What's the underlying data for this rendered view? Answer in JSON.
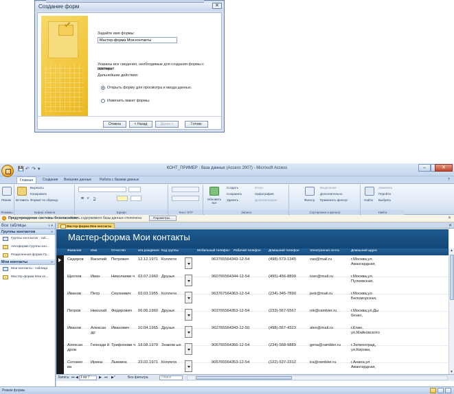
{
  "wizard": {
    "title": "Создание форм",
    "close_glyph": "✕",
    "prompt": "Задайте имя формы:",
    "form_name": "Мастер-форма Мои контакты",
    "info_line1": "Указаны все сведения, необходимые для создания формы с помощью",
    "info_line2": "мастера.",
    "next_actions": "Дальнейшие действия:",
    "option_open": "Открыть форму для просмотра и ввода данных.",
    "option_modify": "Изменить макет формы.",
    "buttons": {
      "cancel": "Отмена",
      "back": "< Назад",
      "next": "Далее >",
      "finish": "Готово"
    }
  },
  "app": {
    "window_title": "КОНТ_ПРИМЕР : база данных (Access 2007) - Microsoft Access",
    "qat": [
      "💾",
      "↶",
      "↷",
      "▾"
    ],
    "window_buttons": {
      "minimize": "–",
      "maximize": "□",
      "close": "✕"
    },
    "tabs": [
      "Главная",
      "Создание",
      "Внешние данные",
      "Работа с базами данных"
    ],
    "help_glyph": "?",
    "ribbon": {
      "modes": {
        "label": "Режимы",
        "view": "Режим"
      },
      "clipboard": {
        "label": "Буфер обмена",
        "paste": "Вставить",
        "cut": "Вырезать",
        "copy": "Копировать",
        "format_painter": "Формат по образцу"
      },
      "font": {
        "label": "Шрифт",
        "bold": "Ж",
        "italic": "К",
        "underline": "Ч"
      },
      "rich_text": {
        "label": "Текст RTF"
      },
      "records": {
        "label": "Записи",
        "refresh": "Обновить все",
        "new": "Создать",
        "save": "Сохранить",
        "delete": "Удалить",
        "totals": "Итоги",
        "spelling": "Орфография",
        "more": "Дополнительно"
      },
      "sort_filter": {
        "label": "Сортировка и фильтр",
        "filter": "Фильтр",
        "selection": "Выделение",
        "advanced": "Дополнительно",
        "toggle": "Применить фильтр"
      },
      "find": {
        "label": "Найти",
        "find": "Найти",
        "replace": "Заменить",
        "goto": "Перейти",
        "select": "Выбрать"
      }
    },
    "security": {
      "title": "Предупреждение системы безопасности",
      "text": "Часть содержимого базы данных отключена",
      "button": "Параметры...",
      "close_glyph": "✕"
    },
    "nav": {
      "title": "Все таблицы",
      "controls": "« ▾",
      "groups": [
        {
          "label": "Группы контактов",
          "items": [
            {
              "label": "Группы контактов : таб...",
              "type": "table"
            },
            {
              "label": "Автоформа Группы кон...",
              "type": "form"
            },
            {
              "label": "Разделенная форма Гр...",
              "type": "form"
            }
          ]
        },
        {
          "label": "Мои контакты",
          "items": [
            {
              "label": "Мои контакты : таблица",
              "type": "table"
            },
            {
              "label": "Мастер-форма Мои ко...",
              "type": "form"
            }
          ]
        }
      ],
      "group_ctl": "»"
    },
    "document": {
      "tab_label": "Мастер-форма Мои контакты",
      "close_glyph": "✕",
      "form_title": "Мастер-форма Мои контакты",
      "columns": [
        "Фамилия",
        "Имя",
        "Отчество",
        "ата рождения",
        "Код группы",
        "Мобильный телефон",
        "Рабочий телефон",
        "Домашний телефон",
        "Электронная почта",
        "Домашний адрес"
      ],
      "rows": [
        [
          "Сидоров",
          "Василий",
          "Петрович",
          "12.12.1971",
          "Коллеги",
          "9637655643",
          "43-12-54",
          "(498)-573-1345",
          "vas@mail.ru",
          "г.Москва,ул. Авангардная,"
        ],
        [
          "Щеглов",
          "Иван",
          "Николаеви ч",
          "03.07.1960",
          "Друзья",
          "9607655643",
          "44-12-54",
          "(495)-456-8899",
          "ivan@mail.ru",
          "г.Москва,ул. Пулковская,"
        ],
        [
          "Иванов",
          "Петр",
          "Сергеевич",
          "03.03.1955",
          "Коллеги",
          "9637675643",
          "63-12-54",
          "(234)-345-7890",
          "petr@mail.ru",
          "г.Москва,ул. Беломорская,"
        ],
        [
          "Петров",
          "Николай",
          "Федорович",
          "06.06.1960",
          "Друзья",
          "9037655643",
          "53-12-54",
          "(233)-567-5567",
          "nik@rambler.ru",
          "г.Москва,ул.Ды бенко,"
        ],
        [
          "Иванов",
          "Алексан др",
          "Иванович",
          "10.04.1965",
          "Друзья",
          "9627655643",
          "43-12-50",
          "(498)-567-4323",
          "alex@mail.ru",
          "г.Клин, ул.Майковского"
        ],
        [
          "Алексан дров",
          "Геннади й",
          "Трифонови ч",
          "18.08.1970",
          "Знаком ые",
          "9067655643",
          "66-12-54",
          "(234)-568-9889",
          "gena@rambler.ru",
          "г.Зеленоград, ул.Кирова,"
        ],
        [
          "Сотнико ва",
          "Ирина",
          "Львовна",
          "23.02.1971",
          "Коллеги",
          "9057655643",
          "53-12-54",
          "(122)-537-2312",
          "ira@rambler.ru",
          "г.Анапа,ул Авангардная,"
        ]
      ]
    },
    "record_nav": {
      "label": "Запись:",
      "first": "⏮",
      "prev": "◀",
      "position": "1 из 7",
      "next": "▶",
      "last": "⏭",
      "new": "▶*",
      "filter": "Без фильтра",
      "search_placeholder": "Поиск"
    },
    "status": "Режим формы"
  }
}
